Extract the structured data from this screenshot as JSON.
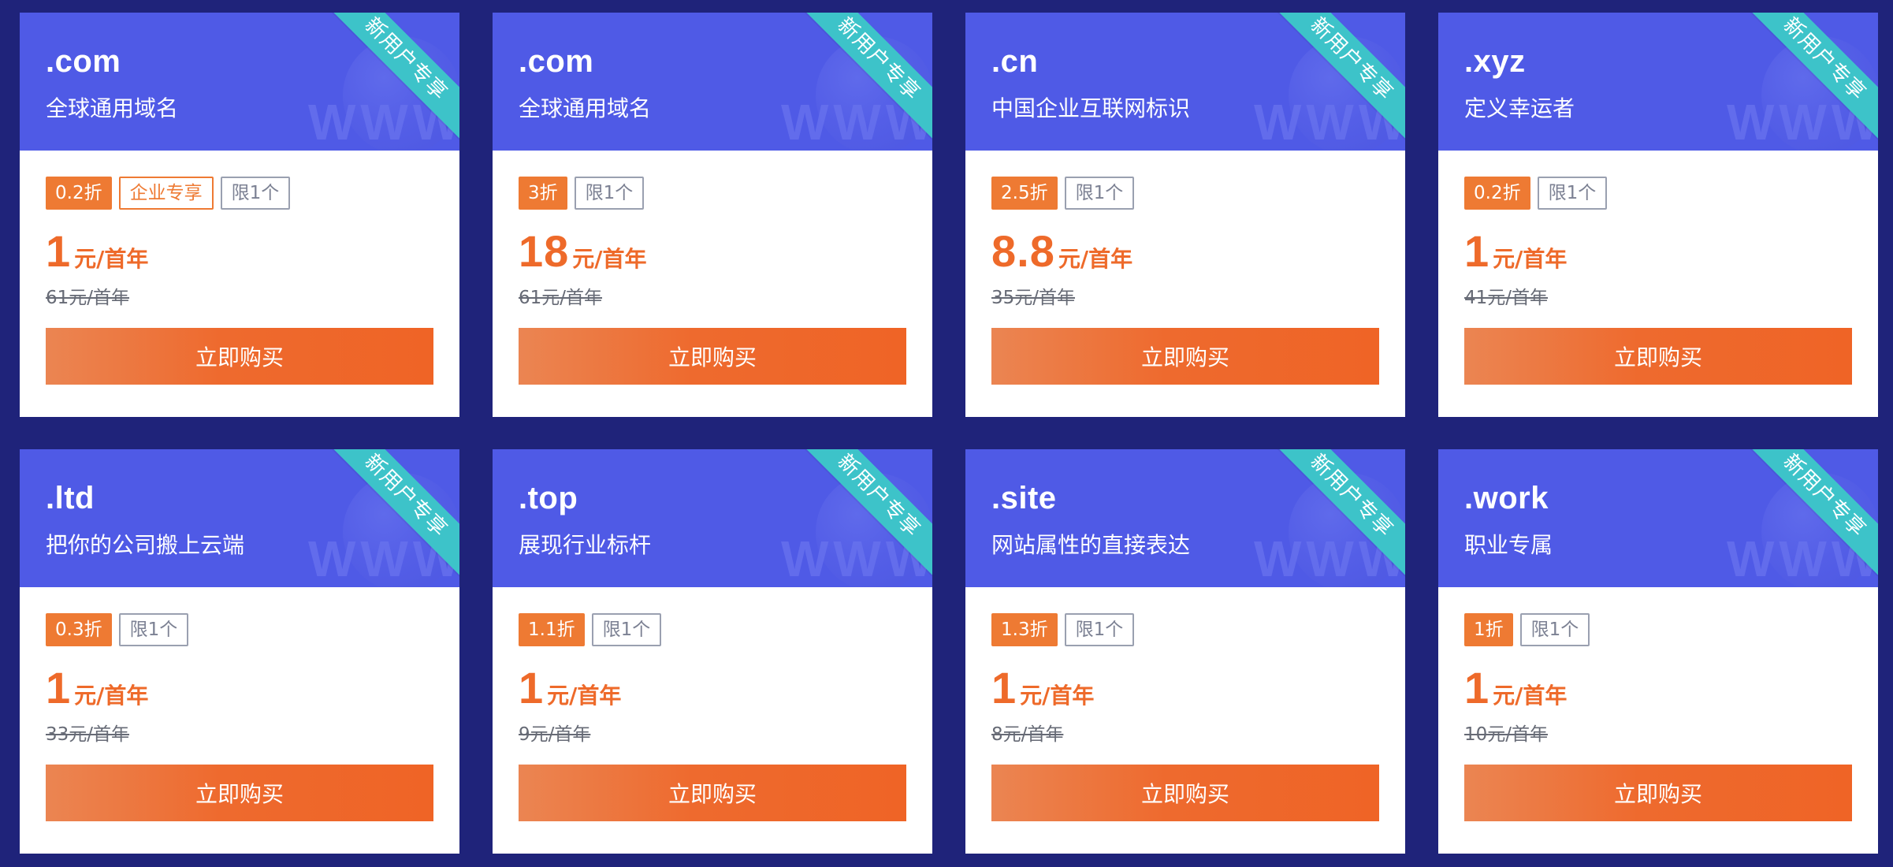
{
  "ribbon_text": "新用户专享",
  "watermark_text": "WWW",
  "colors": {
    "background": "#1f237a",
    "card_header": "#4f5ae6",
    "ribbon": "#3dc3c9",
    "accent_orange": "#ee6a2a",
    "limit_gray": "#9aa0b0"
  },
  "cards": [
    {
      "domain": ".com",
      "description": "全球通用域名",
      "discount": "0.2折",
      "enterprise_tag": "企业专享",
      "limit": "限1个",
      "price": "1",
      "price_unit": "元/首年",
      "original_price": "61元/首年",
      "buy_label": "立即购买"
    },
    {
      "domain": ".com",
      "description": "全球通用域名",
      "discount": "3折",
      "limit": "限1个",
      "price": "18",
      "price_unit": "元/首年",
      "original_price": "61元/首年",
      "buy_label": "立即购买"
    },
    {
      "domain": ".cn",
      "description": "中国企业互联网标识",
      "discount": "2.5折",
      "limit": "限1个",
      "price": "8.8",
      "price_unit": "元/首年",
      "original_price": "35元/首年",
      "buy_label": "立即购买"
    },
    {
      "domain": ".xyz",
      "description": "定义幸运者",
      "discount": "0.2折",
      "limit": "限1个",
      "price": "1",
      "price_unit": "元/首年",
      "original_price": "41元/首年",
      "buy_label": "立即购买"
    },
    {
      "domain": ".ltd",
      "description": "把你的公司搬上云端",
      "discount": "0.3折",
      "limit": "限1个",
      "price": "1",
      "price_unit": "元/首年",
      "original_price": "33元/首年",
      "buy_label": "立即购买"
    },
    {
      "domain": ".top",
      "description": "展现行业标杆",
      "discount": "1.1折",
      "limit": "限1个",
      "price": "1",
      "price_unit": "元/首年",
      "original_price": "9元/首年",
      "buy_label": "立即购买"
    },
    {
      "domain": ".site",
      "description": "网站属性的直接表达",
      "discount": "1.3折",
      "limit": "限1个",
      "price": "1",
      "price_unit": "元/首年",
      "original_price": "8元/首年",
      "buy_label": "立即购买"
    },
    {
      "domain": ".work",
      "description": "职业专属",
      "discount": "1折",
      "limit": "限1个",
      "price": "1",
      "price_unit": "元/首年",
      "original_price": "10元/首年",
      "buy_label": "立即购买"
    }
  ]
}
